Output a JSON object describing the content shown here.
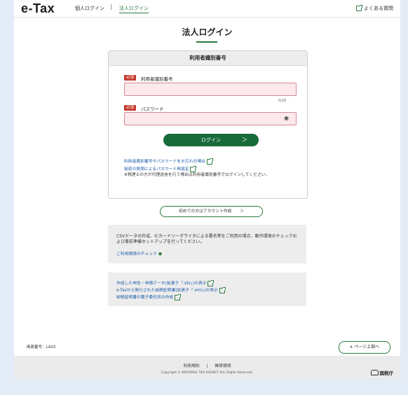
{
  "header": {
    "logo": "e-Tax",
    "tab_personal": "個人ログイン",
    "separator": "|",
    "tab_corporate": "法人ログイン",
    "faq": "よくある質問"
  },
  "main": {
    "title": "法人ログイン",
    "form": {
      "section_title": "利用者識別番号",
      "required_badge": "必須",
      "id_label": "利用者識別番号",
      "id_value": "",
      "counter": "0/16",
      "password_label": "パスワード",
      "password_value": "",
      "login_button": "ログイン",
      "login_arrow": "＞",
      "links": [
        "利用者識別番号やパスワードをお忘れの場合",
        "秘密の質問によるパスワード再設定"
      ],
      "note": "※税理士の方が代理送信を行う場合は利用者識別番号でログインしてください。"
    },
    "create_account_button": "初めての方はアカウント作成",
    "create_account_arrow": "＞",
    "env_box": {
      "text": "CSVデータの作成、ICカードリーダライタによる署名等をご利用の場合、動作環境のチェックおよび事前準備セットアップを行ってください。",
      "link": "ご利用環境のチェック"
    },
    "tools_box": {
      "links": [
        "作成した申告・申請データ(拡張子「.xtx」)の表示",
        "e-Taxから発行された納税証明書(拡張子「.xml」)の表示",
        "納税証明書の電子委任状の作成"
      ]
    }
  },
  "page_number": "画面番号：LA02",
  "to_top": "ページ上部へ",
  "footer": {
    "terms": "利用規約",
    "separator": "|",
    "env": "推奨環境",
    "copyright": "Copyright © NATIONAL TAX AGENCY ALL Rights Reserved.",
    "agency": "国税庁"
  },
  "colors": {
    "accent": "#186a3b",
    "required": "#c5362b",
    "input_bg": "#fbe9ec",
    "link": "#1a5aa8"
  }
}
